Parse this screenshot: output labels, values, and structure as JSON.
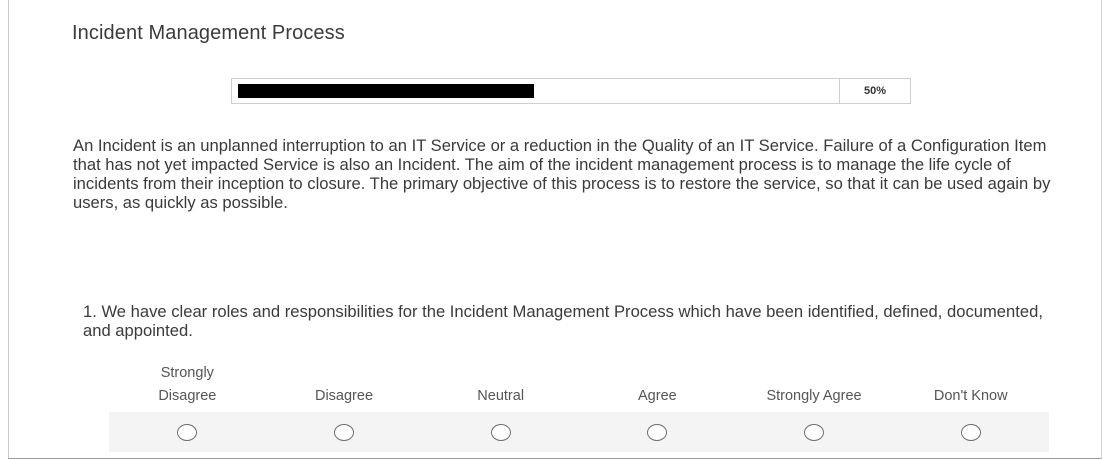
{
  "survey": {
    "title": "Incident Management Process",
    "progress": {
      "percent": 50,
      "label": "50%"
    },
    "intro": "An Incident is an unplanned interruption to an IT Service or a reduction in the Quality of an IT Service. Failure of a Configuration Item that has not yet impacted Service is also an Incident. The aim of the incident management process is to manage the life cycle of incidents from their inception to closure. The primary objective of this process is to restore the service, so that it can be used again by users, as quickly as possible.",
    "question": {
      "text": "1. We have clear roles and responsibilities for the Incident Management Process which have been identified, defined, documented, and appointed.",
      "options": [
        {
          "label_line1": "Strongly",
          "label_line2": "Disagree",
          "selected": false
        },
        {
          "label_line1": "",
          "label_line2": "Disagree",
          "selected": false
        },
        {
          "label_line1": "",
          "label_line2": "Neutral",
          "selected": false
        },
        {
          "label_line1": "",
          "label_line2": "Agree",
          "selected": false
        },
        {
          "label_line1": "",
          "label_line2": "Strongly Agree",
          "selected": false
        },
        {
          "label_line1": "",
          "label_line2": "Don't Know",
          "selected": false
        }
      ]
    }
  },
  "colors": {
    "progress_fill": "#000000",
    "text": "#3a3a3a",
    "option_row_bg": "#f4f4f4",
    "radio_border": "#6f6f6f"
  }
}
